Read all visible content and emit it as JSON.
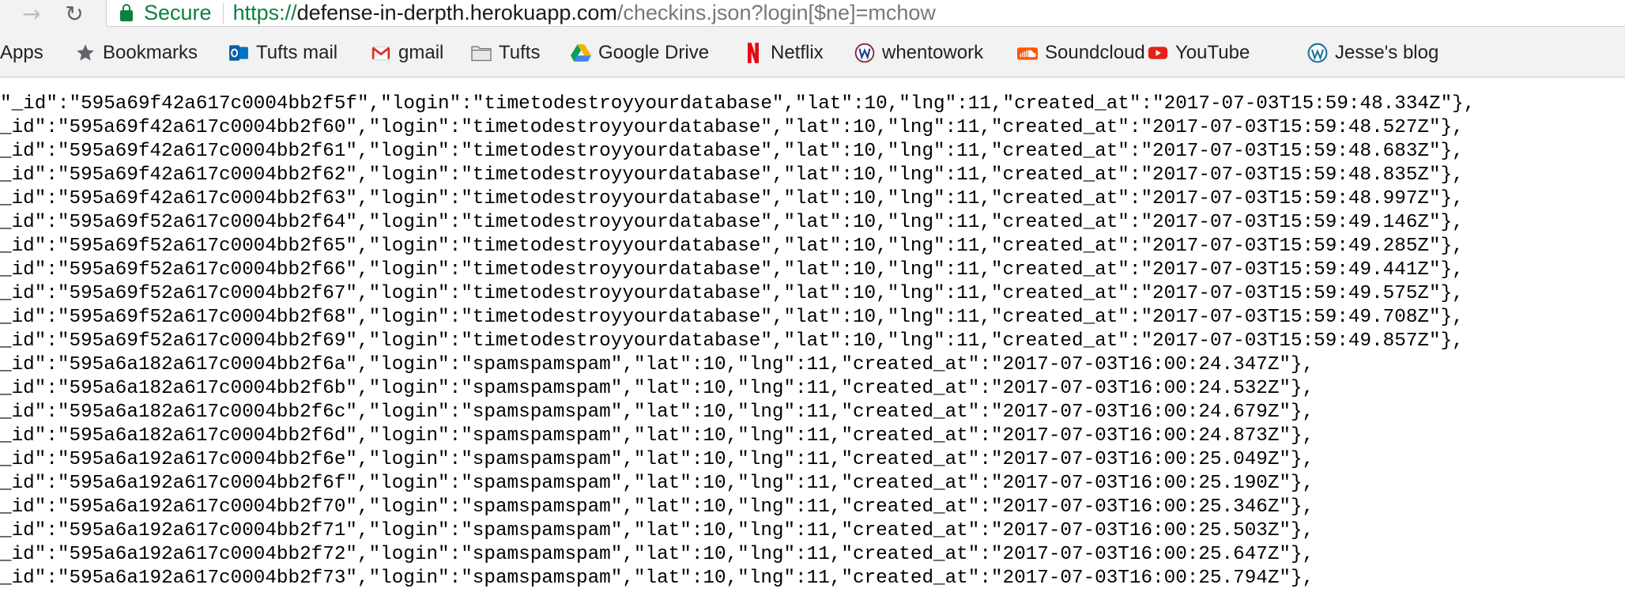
{
  "browser": {
    "secure_label": "Secure",
    "url": {
      "scheme": "https://",
      "host": "defense-in-derpth.herokuapp.com",
      "path": "/checkins.json?login[$ne]=mchow"
    },
    "colors": {
      "secure": "#0b8043",
      "toolbar": "#f2f2f2"
    }
  },
  "bookmarks": {
    "items": [
      {
        "label": "Apps",
        "icon": "apps-grid-icon"
      },
      {
        "label": "Bookmarks",
        "icon": "star-icon"
      },
      {
        "label": "Tufts mail",
        "icon": "outlook-icon"
      },
      {
        "label": "gmail",
        "icon": "gmail-icon"
      },
      {
        "label": "Tufts",
        "icon": "folder-icon"
      },
      {
        "label": "Google Drive",
        "icon": "google-drive-icon"
      },
      {
        "label": "Netflix",
        "icon": "netflix-icon"
      },
      {
        "label": "whentowork",
        "icon": "whentowork-icon"
      },
      {
        "label": "Soundcloud",
        "icon": "soundcloud-icon"
      },
      {
        "label": "YouTube",
        "icon": "youtube-icon"
      },
      {
        "label": "Jesse's blog",
        "icon": "wordpress-icon"
      }
    ]
  },
  "json_lines": [
    "\"_id\":\"595a69f42a617c0004bb2f5f\",\"login\":\"timetodestroyyourdatabase\",\"lat\":10,\"lng\":11,\"created_at\":\"2017-07-03T15:59:48.334Z\"},",
    "_id\":\"595a69f42a617c0004bb2f60\",\"login\":\"timetodestroyyourdatabase\",\"lat\":10,\"lng\":11,\"created_at\":\"2017-07-03T15:59:48.527Z\"},",
    "_id\":\"595a69f42a617c0004bb2f61\",\"login\":\"timetodestroyyourdatabase\",\"lat\":10,\"lng\":11,\"created_at\":\"2017-07-03T15:59:48.683Z\"},",
    "_id\":\"595a69f42a617c0004bb2f62\",\"login\":\"timetodestroyyourdatabase\",\"lat\":10,\"lng\":11,\"created_at\":\"2017-07-03T15:59:48.835Z\"},",
    "_id\":\"595a69f42a617c0004bb2f63\",\"login\":\"timetodestroyyourdatabase\",\"lat\":10,\"lng\":11,\"created_at\":\"2017-07-03T15:59:48.997Z\"},",
    "_id\":\"595a69f52a617c0004bb2f64\",\"login\":\"timetodestroyyourdatabase\",\"lat\":10,\"lng\":11,\"created_at\":\"2017-07-03T15:59:49.146Z\"},",
    "_id\":\"595a69f52a617c0004bb2f65\",\"login\":\"timetodestroyyourdatabase\",\"lat\":10,\"lng\":11,\"created_at\":\"2017-07-03T15:59:49.285Z\"},",
    "_id\":\"595a69f52a617c0004bb2f66\",\"login\":\"timetodestroyyourdatabase\",\"lat\":10,\"lng\":11,\"created_at\":\"2017-07-03T15:59:49.441Z\"},",
    "_id\":\"595a69f52a617c0004bb2f67\",\"login\":\"timetodestroyyourdatabase\",\"lat\":10,\"lng\":11,\"created_at\":\"2017-07-03T15:59:49.575Z\"},",
    "_id\":\"595a69f52a617c0004bb2f68\",\"login\":\"timetodestroyyourdatabase\",\"lat\":10,\"lng\":11,\"created_at\":\"2017-07-03T15:59:49.708Z\"},",
    "_id\":\"595a69f52a617c0004bb2f69\",\"login\":\"timetodestroyyourdatabase\",\"lat\":10,\"lng\":11,\"created_at\":\"2017-07-03T15:59:49.857Z\"},",
    "_id\":\"595a6a182a617c0004bb2f6a\",\"login\":\"spamspamspam\",\"lat\":10,\"lng\":11,\"created_at\":\"2017-07-03T16:00:24.347Z\"},",
    "_id\":\"595a6a182a617c0004bb2f6b\",\"login\":\"spamspamspam\",\"lat\":10,\"lng\":11,\"created_at\":\"2017-07-03T16:00:24.532Z\"},",
    "_id\":\"595a6a182a617c0004bb2f6c\",\"login\":\"spamspamspam\",\"lat\":10,\"lng\":11,\"created_at\":\"2017-07-03T16:00:24.679Z\"},",
    "_id\":\"595a6a182a617c0004bb2f6d\",\"login\":\"spamspamspam\",\"lat\":10,\"lng\":11,\"created_at\":\"2017-07-03T16:00:24.873Z\"},",
    "_id\":\"595a6a192a617c0004bb2f6e\",\"login\":\"spamspamspam\",\"lat\":10,\"lng\":11,\"created_at\":\"2017-07-03T16:00:25.049Z\"},",
    "_id\":\"595a6a192a617c0004bb2f6f\",\"login\":\"spamspamspam\",\"lat\":10,\"lng\":11,\"created_at\":\"2017-07-03T16:00:25.190Z\"},",
    "_id\":\"595a6a192a617c0004bb2f70\",\"login\":\"spamspamspam\",\"lat\":10,\"lng\":11,\"created_at\":\"2017-07-03T16:00:25.346Z\"},",
    "_id\":\"595a6a192a617c0004bb2f71\",\"login\":\"spamspamspam\",\"lat\":10,\"lng\":11,\"created_at\":\"2017-07-03T16:00:25.503Z\"},",
    "_id\":\"595a6a192a617c0004bb2f72\",\"login\":\"spamspamspam\",\"lat\":10,\"lng\":11,\"created_at\":\"2017-07-03T16:00:25.647Z\"},",
    "_id\":\"595a6a192a617c0004bb2f73\",\"login\":\"spamspamspam\",\"lat\":10,\"lng\":11,\"created_at\":\"2017-07-03T16:00:25.794Z\"},"
  ]
}
